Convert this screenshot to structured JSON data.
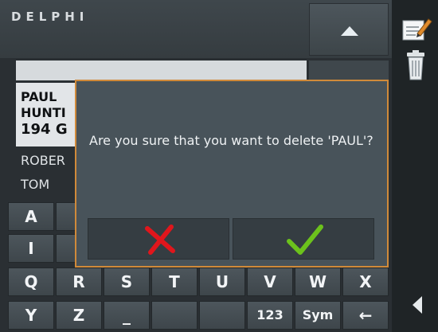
{
  "header": {
    "logo": "DELPHI",
    "scroll_up_icon": "arrow-up-icon"
  },
  "search": {
    "value": ""
  },
  "list": {
    "selected": {
      "line1": "PAUL",
      "line2": "HUNTI",
      "line3": "194 G"
    },
    "items": [
      {
        "label": "ROBER"
      },
      {
        "label": "TOM"
      }
    ]
  },
  "keyboard": {
    "row1": [
      "A",
      "",
      "",
      "",
      "",
      "",
      "",
      ""
    ],
    "row2": [
      "I",
      "",
      "",
      "",
      "",
      "",
      "",
      ""
    ],
    "row3": [
      "Q",
      "R",
      "S",
      "T",
      "U",
      "V",
      "W",
      "X"
    ],
    "row4": [
      "Y",
      "Z",
      "_",
      "",
      "",
      "123",
      "Sym",
      "←"
    ]
  },
  "toolbar": {
    "edit_icon": "edit-note-icon",
    "delete_icon": "trash-icon",
    "back_icon": "back-arrow-icon"
  },
  "dialog": {
    "message": "Are you sure that you want to delete 'PAUL'?",
    "cancel_icon": "red-x-icon",
    "confirm_icon": "green-check-icon"
  },
  "colors": {
    "dialog_border": "#d08a3a",
    "cancel": "#e0161c",
    "confirm": "#6cc21c"
  }
}
